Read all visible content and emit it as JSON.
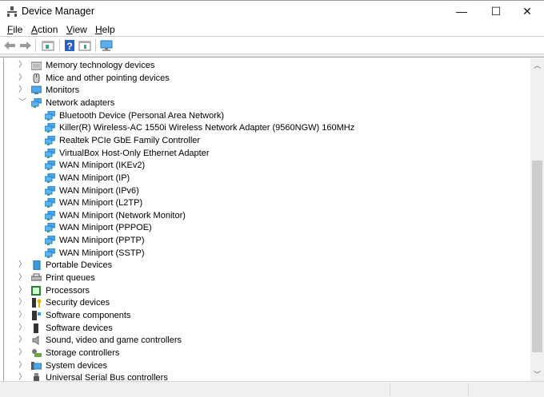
{
  "window": {
    "title": "Device Manager",
    "minimize": "—",
    "maximize": "☐",
    "close": "✕"
  },
  "menu": [
    {
      "key": "F",
      "rest": "ile"
    },
    {
      "key": "A",
      "rest": "ction"
    },
    {
      "key": "V",
      "rest": "iew"
    },
    {
      "key": "H",
      "rest": "elp"
    }
  ],
  "tree": [
    {
      "label": "Memory technology devices",
      "level": 1,
      "state": "collapsed",
      "icon": "memory-icon"
    },
    {
      "label": "Mice and other pointing devices",
      "level": 1,
      "state": "collapsed",
      "icon": "mouse-icon"
    },
    {
      "label": "Monitors",
      "level": 1,
      "state": "collapsed",
      "icon": "monitor-icon"
    },
    {
      "label": "Network adapters",
      "level": 1,
      "state": "expanded",
      "icon": "network-icon"
    },
    {
      "label": "Bluetooth Device (Personal Area Network)",
      "level": 2,
      "icon": "network-adapter-icon"
    },
    {
      "label": "Killer(R) Wireless-AC 1550i Wireless Network Adapter (9560NGW) 160MHz",
      "level": 2,
      "icon": "network-adapter-icon"
    },
    {
      "label": "Realtek PCIe GbE Family Controller",
      "level": 2,
      "icon": "network-adapter-icon"
    },
    {
      "label": "VirtualBox Host-Only Ethernet Adapter",
      "level": 2,
      "icon": "network-adapter-icon"
    },
    {
      "label": "WAN Miniport (IKEv2)",
      "level": 2,
      "icon": "network-adapter-icon"
    },
    {
      "label": "WAN Miniport (IP)",
      "level": 2,
      "icon": "network-adapter-icon"
    },
    {
      "label": "WAN Miniport (IPv6)",
      "level": 2,
      "icon": "network-adapter-icon"
    },
    {
      "label": "WAN Miniport (L2TP)",
      "level": 2,
      "icon": "network-adapter-icon"
    },
    {
      "label": "WAN Miniport (Network Monitor)",
      "level": 2,
      "icon": "network-adapter-icon"
    },
    {
      "label": "WAN Miniport (PPPOE)",
      "level": 2,
      "icon": "network-adapter-icon"
    },
    {
      "label": "WAN Miniport (PPTP)",
      "level": 2,
      "icon": "network-adapter-icon"
    },
    {
      "label": "WAN Miniport (SSTP)",
      "level": 2,
      "icon": "network-adapter-icon"
    },
    {
      "label": "Portable Devices",
      "level": 1,
      "state": "collapsed",
      "icon": "portable-device-icon"
    },
    {
      "label": "Print queues",
      "level": 1,
      "state": "collapsed",
      "icon": "printer-icon"
    },
    {
      "label": "Processors",
      "level": 1,
      "state": "collapsed",
      "icon": "processor-icon"
    },
    {
      "label": "Security devices",
      "level": 1,
      "state": "collapsed",
      "icon": "security-icon"
    },
    {
      "label": "Software components",
      "level": 1,
      "state": "collapsed",
      "icon": "software-component-icon"
    },
    {
      "label": "Software devices",
      "level": 1,
      "state": "collapsed",
      "icon": "software-device-icon"
    },
    {
      "label": "Sound, video and game controllers",
      "level": 1,
      "state": "collapsed",
      "icon": "speaker-icon"
    },
    {
      "label": "Storage controllers",
      "level": 1,
      "state": "collapsed",
      "icon": "storage-icon"
    },
    {
      "label": "System devices",
      "level": 1,
      "state": "collapsed",
      "icon": "system-icon"
    },
    {
      "label": "Universal Serial Bus controllers",
      "level": 1,
      "state": "collapsed",
      "icon": "usb-icon"
    }
  ],
  "colors": {
    "network": "#3c9ee0",
    "green": "#2aa84a",
    "chevron": "#777777"
  }
}
